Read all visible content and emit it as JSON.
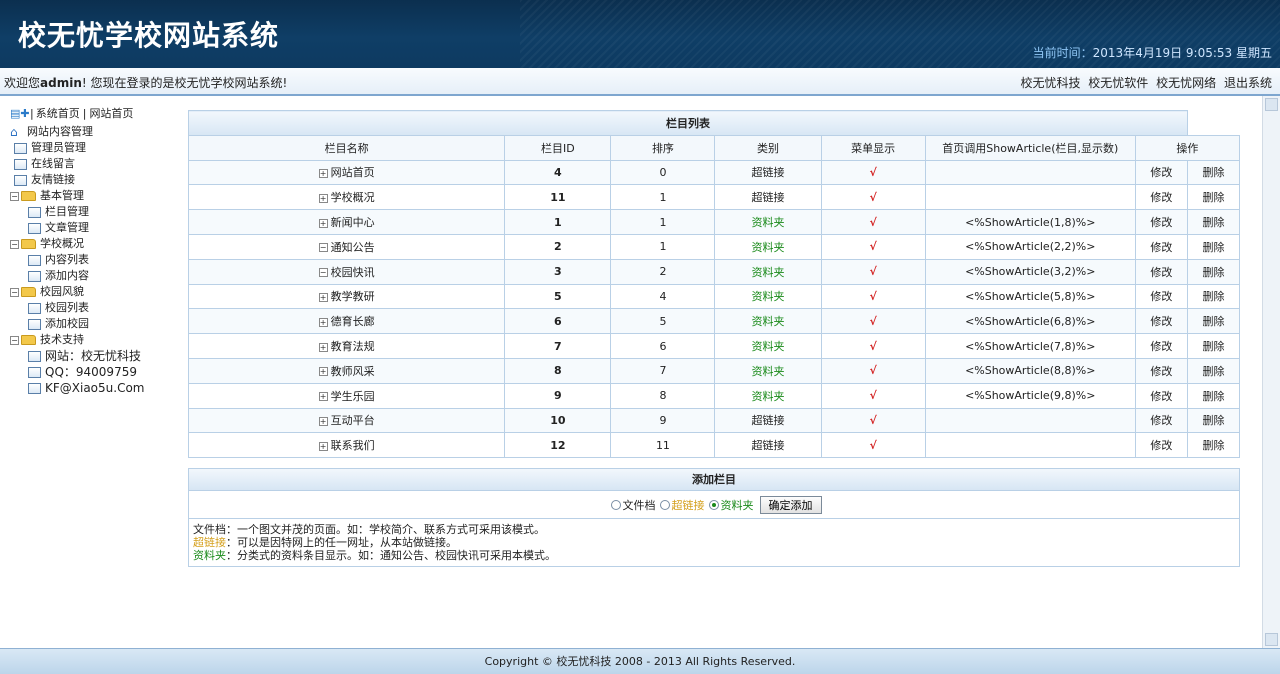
{
  "header": {
    "title": "校无忧学校网站系统",
    "time_label": "当前时间：",
    "time_value": "2013年4月19日  9:05:53 星期五"
  },
  "welcome": {
    "prefix": "欢迎您",
    "user": "admin",
    "suffix": "! 您现在登录的是校无忧学校网站系统!"
  },
  "top_links": [
    "校无忧科技",
    "校无忧软件",
    "校无忧网络",
    "退出系统"
  ],
  "sidebar": {
    "top_link_home": "系统首页",
    "top_sep": "|",
    "top_link_site": "网站首页",
    "root": "网站内容管理",
    "items": {
      "admin": "管理员管理",
      "guestbook": "在线留言",
      "links": "友情链接",
      "basic": "基本管理",
      "column": "栏目管理",
      "article": "文章管理",
      "school": "学校概况",
      "content_list": "内容列表",
      "add_content": "添加内容",
      "campus": "校园风貌",
      "campus_list": "校园列表",
      "add_campus": "添加校园",
      "support": "技术支持",
      "site": "网站：校无忧科技",
      "qq": "QQ：94009759",
      "email": "KF@Xiao5u.Com"
    }
  },
  "table": {
    "caption": "栏目列表",
    "headers": [
      "栏目名称",
      "栏目ID",
      "排序",
      "类别",
      "菜单显示",
      "首页调用ShowArticle(栏目,显示数)",
      "操作"
    ],
    "rows": [
      {
        "exp": "+",
        "name": "网站首页",
        "id": "4",
        "order": "0",
        "type": "超链接",
        "menu": "√",
        "call": "",
        "edit": "修改",
        "del": "删除"
      },
      {
        "exp": "+",
        "name": "学校概况",
        "id": "11",
        "order": "1",
        "type": "超链接",
        "menu": "√",
        "call": "",
        "edit": "修改",
        "del": "删除"
      },
      {
        "exp": "+",
        "name": "新闻中心",
        "id": "1",
        "order": "1",
        "type": "资料夹",
        "menu": "√",
        "call": "<%ShowArticle(1,8)%>",
        "edit": "修改",
        "del": "删除"
      },
      {
        "exp": "−",
        "name": "通知公告",
        "id": "2",
        "order": "1",
        "type": "资料夹",
        "menu": "√",
        "call": "<%ShowArticle(2,2)%>",
        "edit": "修改",
        "del": "删除"
      },
      {
        "exp": "−",
        "name": "校园快讯",
        "id": "3",
        "order": "2",
        "type": "资料夹",
        "menu": "√",
        "call": "<%ShowArticle(3,2)%>",
        "edit": "修改",
        "del": "删除"
      },
      {
        "exp": "+",
        "name": "教学教研",
        "id": "5",
        "order": "4",
        "type": "资料夹",
        "menu": "√",
        "call": "<%ShowArticle(5,8)%>",
        "edit": "修改",
        "del": "删除"
      },
      {
        "exp": "+",
        "name": "德育长廊",
        "id": "6",
        "order": "5",
        "type": "资料夹",
        "menu": "√",
        "call": "<%ShowArticle(6,8)%>",
        "edit": "修改",
        "del": "删除"
      },
      {
        "exp": "+",
        "name": "教育法规",
        "id": "7",
        "order": "6",
        "type": "资料夹",
        "menu": "√",
        "call": "<%ShowArticle(7,8)%>",
        "edit": "修改",
        "del": "删除"
      },
      {
        "exp": "+",
        "name": "教师风采",
        "id": "8",
        "order": "7",
        "type": "资料夹",
        "menu": "√",
        "call": "<%ShowArticle(8,8)%>",
        "edit": "修改",
        "del": "删除"
      },
      {
        "exp": "+",
        "name": "学生乐园",
        "id": "9",
        "order": "8",
        "type": "资料夹",
        "menu": "√",
        "call": "<%ShowArticle(9,8)%>",
        "edit": "修改",
        "del": "删除"
      },
      {
        "exp": "+",
        "name": "互动平台",
        "id": "10",
        "order": "9",
        "type": "超链接",
        "menu": "√",
        "call": "",
        "edit": "修改",
        "del": "删除"
      },
      {
        "exp": "+",
        "name": "联系我们",
        "id": "12",
        "order": "11",
        "type": "超链接",
        "menu": "√",
        "call": "",
        "edit": "修改",
        "del": "删除"
      }
    ]
  },
  "add_panel": {
    "caption": "添加栏目",
    "options": [
      "文件档",
      "超链接",
      "资料夹"
    ],
    "selected": "资料夹",
    "button": "确定添加",
    "desc": [
      {
        "key": "文件档",
        "text": "：一个图文并茂的页面。如：学校简介、联系方式可采用该模式。"
      },
      {
        "key": "超链接",
        "text": "：可以是因特网上的任一网址，从本站做链接。"
      },
      {
        "key": "资料夹",
        "text": "：分类式的资料条目显示。如：通知公告、校园快讯可采用本模式。"
      }
    ]
  },
  "footer": {
    "text": "Copyright © 校无忧科技  2008 - 2013 All Rights Reserved."
  },
  "colors": {
    "banner": "#0f3e66",
    "folder_type": "#1a8a1a",
    "link_type": "#d49f1a",
    "check": "#d32222"
  }
}
